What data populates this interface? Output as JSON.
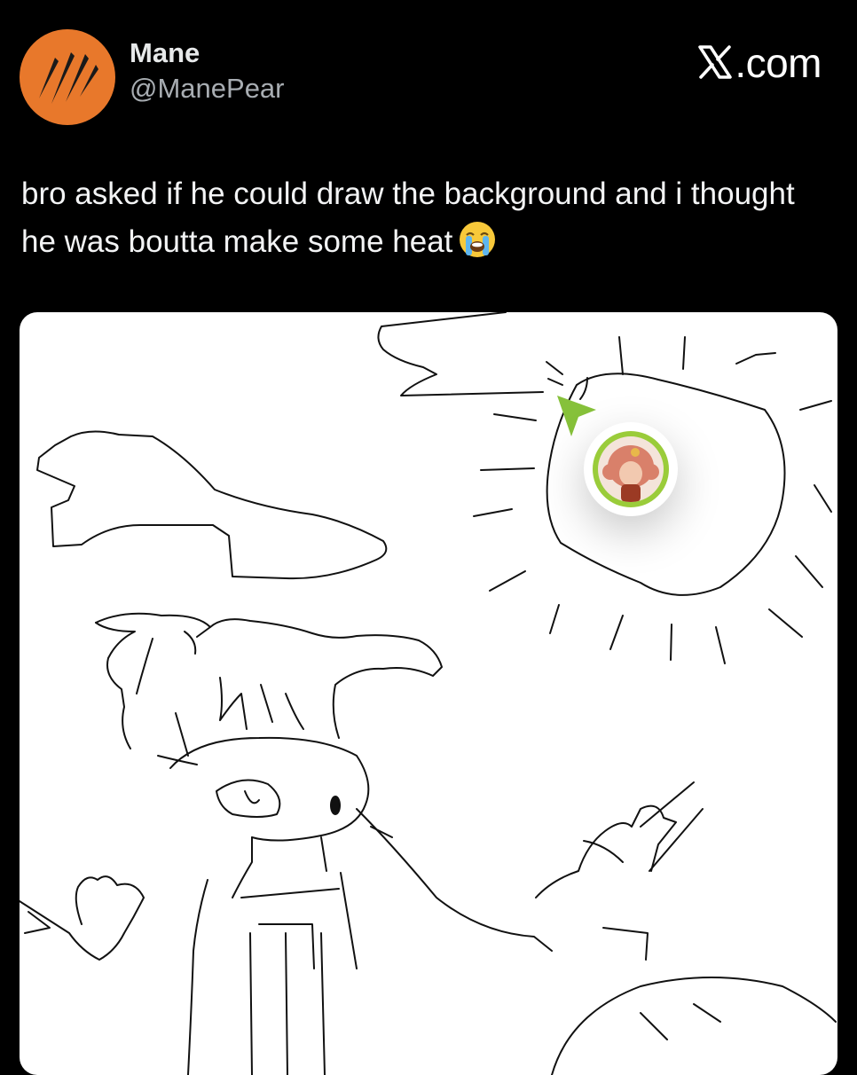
{
  "post": {
    "author_name": "Mane",
    "author_handle": "@ManePear",
    "brand": ".com",
    "text": "bro asked if he could draw the background and i thought he was boutta make some heat",
    "emoji": "loudly-crying-face-emoji"
  },
  "icons": {
    "avatar": "claw-marks-icon",
    "brand": "x-logo-icon",
    "pointer": "map-pointer-arrow-icon"
  },
  "colors": {
    "background": "#000000",
    "avatar_bg": "#e8782b",
    "pin_ring": "#9acc3a",
    "handle_text": "#a8adb2"
  }
}
